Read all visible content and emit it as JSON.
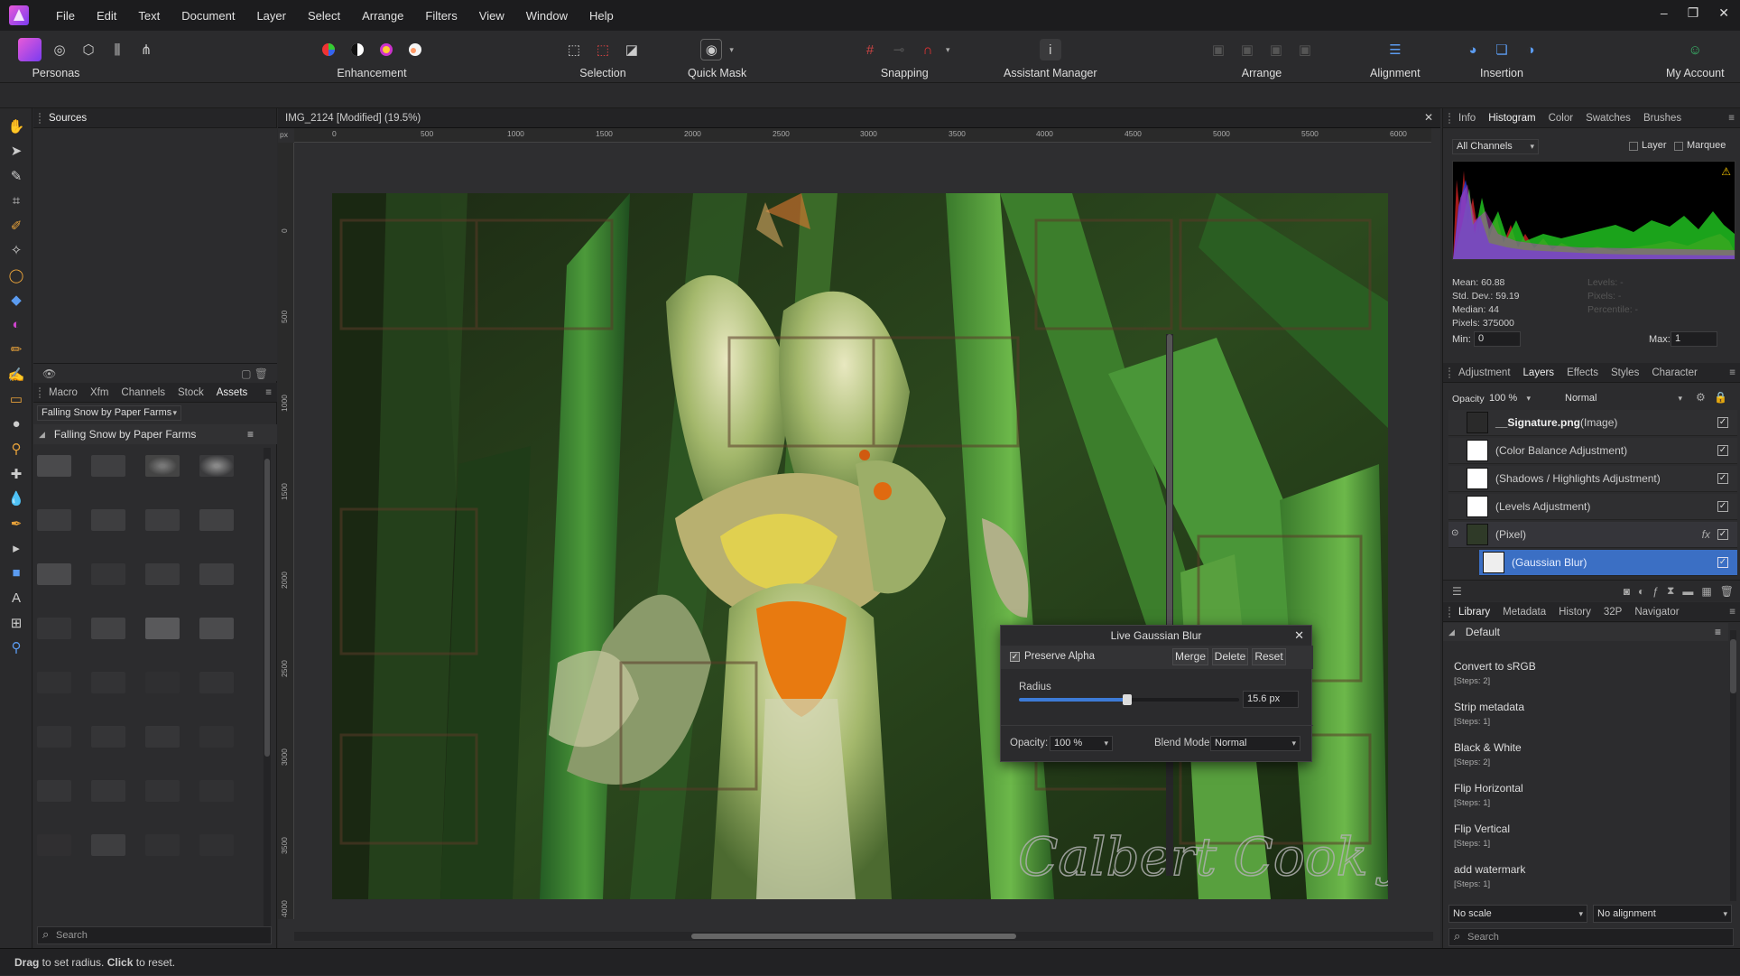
{
  "menubar": {
    "items": [
      "File",
      "Edit",
      "Text",
      "Document",
      "Layer",
      "Select",
      "Arrange",
      "Filters",
      "View",
      "Window",
      "Help"
    ],
    "window_controls": [
      "–",
      "❐",
      "✕"
    ]
  },
  "toolbar": {
    "personas_label": "Personas",
    "enhancement_label": "Enhancement",
    "selection_label": "Selection",
    "quickmask_label": "Quick Mask",
    "snapping_label": "Snapping",
    "assistant_label": "Assistant Manager",
    "arrange_label": "Arrange",
    "alignment_label": "Alignment",
    "insertion_label": "Insertion",
    "account_label": "My Account"
  },
  "left_panel": {
    "sources_tab": "Sources",
    "tabs": [
      "Macro",
      "Xfm",
      "Channels",
      "Stock",
      "Assets"
    ],
    "active_tab": "Assets",
    "category_select": "Falling Snow by Paper Farms",
    "category_title": "Falling Snow by Paper Farms",
    "search_placeholder": "Search"
  },
  "document": {
    "title": "IMG_2124 [Modified] (19.5%)",
    "ruler_unit": "px",
    "ruler_top_ticks": [
      "0",
      "500",
      "1000",
      "1500",
      "2000",
      "2500",
      "3000",
      "3500",
      "4000",
      "4500",
      "5000",
      "5500",
      "6000"
    ],
    "ruler_left_ticks": [
      "0",
      "500",
      "1000",
      "1500",
      "2000",
      "2500",
      "3000",
      "3500",
      "4000"
    ],
    "watermark_text": "Calbert Cook Jr."
  },
  "dialog": {
    "title": "Live Gaussian Blur",
    "preserve_alpha_label": "Preserve Alpha",
    "preserve_alpha_checked": true,
    "merge_label": "Merge",
    "delete_label": "Delete",
    "reset_label": "Reset",
    "radius_label": "Radius",
    "radius_value": "15.6 px",
    "radius_fraction": 0.49,
    "opacity_label": "Opacity:",
    "opacity_value": "100 %",
    "blend_label": "Blend Mode:",
    "blend_value": "Normal"
  },
  "right_panel": {
    "top_tabs": [
      "Info",
      "Histogram",
      "Color",
      "Swatches",
      "Brushes"
    ],
    "top_active": "Histogram",
    "channel_select": "All Channels",
    "layer_option": "Layer",
    "marquee_option": "Marquee",
    "stats": {
      "mean": "Mean: 60.88",
      "stddev": "Std. Dev.: 59.19",
      "median": "Median: 44",
      "pixels": "Pixels: 375000",
      "levels": "Levels: -",
      "pixels2": "Pixels: -",
      "percentile": "Percentile: -"
    },
    "min_label": "Min:",
    "min_value": "0",
    "max_label": "Max:",
    "max_value": "1",
    "mid_tabs": [
      "Adjustment",
      "Layers",
      "Effects",
      "Styles",
      "Character"
    ],
    "mid_active": "Layers",
    "opacity_label": "Opacity:",
    "opacity_value": "100 %",
    "blend_value": "Normal",
    "layers": [
      {
        "name": "__Signature.png",
        "suffix": " (Image)"
      },
      {
        "name": "(Color Balance Adjustment)",
        "suffix": ""
      },
      {
        "name": "(Shadows / Highlights Adjustment)",
        "suffix": ""
      },
      {
        "name": "(Levels Adjustment)",
        "suffix": ""
      },
      {
        "name": "(Pixel)",
        "suffix": ""
      },
      {
        "name": "(Gaussian Blur)",
        "suffix": ""
      }
    ],
    "bottom_tabs": [
      "Library",
      "Metadata",
      "History",
      "32P",
      "Navigator"
    ],
    "bottom_active": "Library",
    "library_group": "Default",
    "macros": [
      {
        "name": "Convert to sRGB",
        "steps": "[Steps: 2]"
      },
      {
        "name": "Strip metadata",
        "steps": "[Steps: 1]"
      },
      {
        "name": "Black & White",
        "steps": "[Steps: 2]"
      },
      {
        "name": "Flip Horizontal",
        "steps": "[Steps: 1]"
      },
      {
        "name": "Flip Vertical",
        "steps": "[Steps: 1]"
      },
      {
        "name": "add watermark",
        "steps": "[Steps: 1]"
      }
    ],
    "scale_select": "No scale",
    "align_select": "No alignment",
    "search_placeholder": "Search"
  },
  "status": {
    "drag": "Drag",
    "drag_text": " to set radius. ",
    "click": "Click",
    "click_text": " to reset."
  },
  "colors": {
    "accent": "#3d7bd6",
    "selected_layer": "#3b6fc4",
    "warning": "#f2c200"
  }
}
